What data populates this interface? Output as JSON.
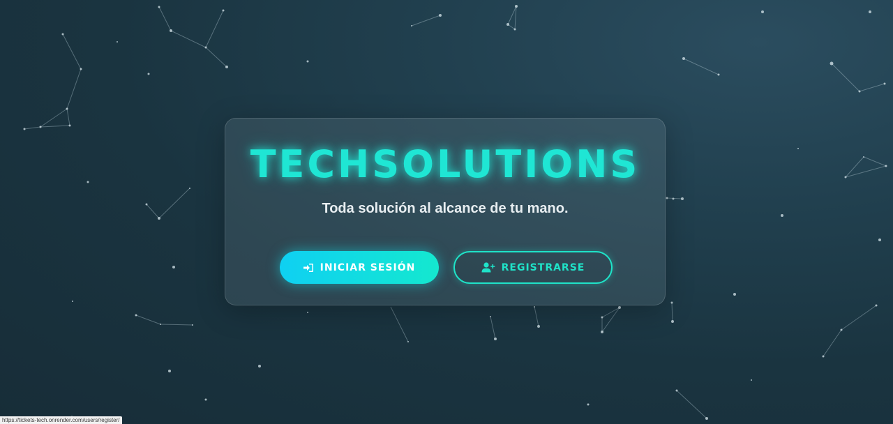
{
  "brand": {
    "title": "TECHSOLUTIONS",
    "tagline": "Toda solución al alcance de tu mano."
  },
  "actions": {
    "login": {
      "label": "INICIAR SESIÓN",
      "icon": "sign-in-icon"
    },
    "register": {
      "label": "REGISTRARSE",
      "icon": "user-plus-icon"
    }
  },
  "status_bar": {
    "url": "https://tickets-tech.onrender.com/users/register/"
  },
  "colors": {
    "accent": "#1fe6d4",
    "background": "#1d3846",
    "login_gradient_start": "#0fd0f2",
    "login_gradient_end": "#14e8cf"
  }
}
